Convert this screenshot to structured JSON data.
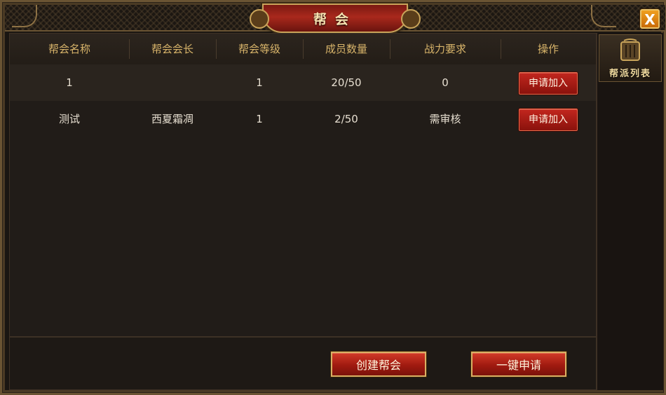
{
  "window": {
    "title": "帮会"
  },
  "table": {
    "headers": [
      "帮会名称",
      "帮会会长",
      "帮会等级",
      "成员数量",
      "战力要求",
      "操作"
    ],
    "rows": [
      {
        "name": "1",
        "leader": "",
        "level": "1",
        "members": "20/50",
        "power_req": "0",
        "action": "申请加入"
      },
      {
        "name": "测试",
        "leader": "西夏霜凋",
        "level": "1",
        "members": "2/50",
        "power_req": "需审核",
        "action": "申请加入"
      }
    ]
  },
  "buttons": {
    "create": "创建帮会",
    "quick_apply": "一键申请",
    "close": "X"
  },
  "side_tabs": [
    {
      "label": "帮派列表",
      "icon": "book-icon"
    }
  ],
  "colors": {
    "accent_gold": "#d8b46a",
    "button_red": "#a01a10",
    "close_orange": "#e08a14"
  }
}
